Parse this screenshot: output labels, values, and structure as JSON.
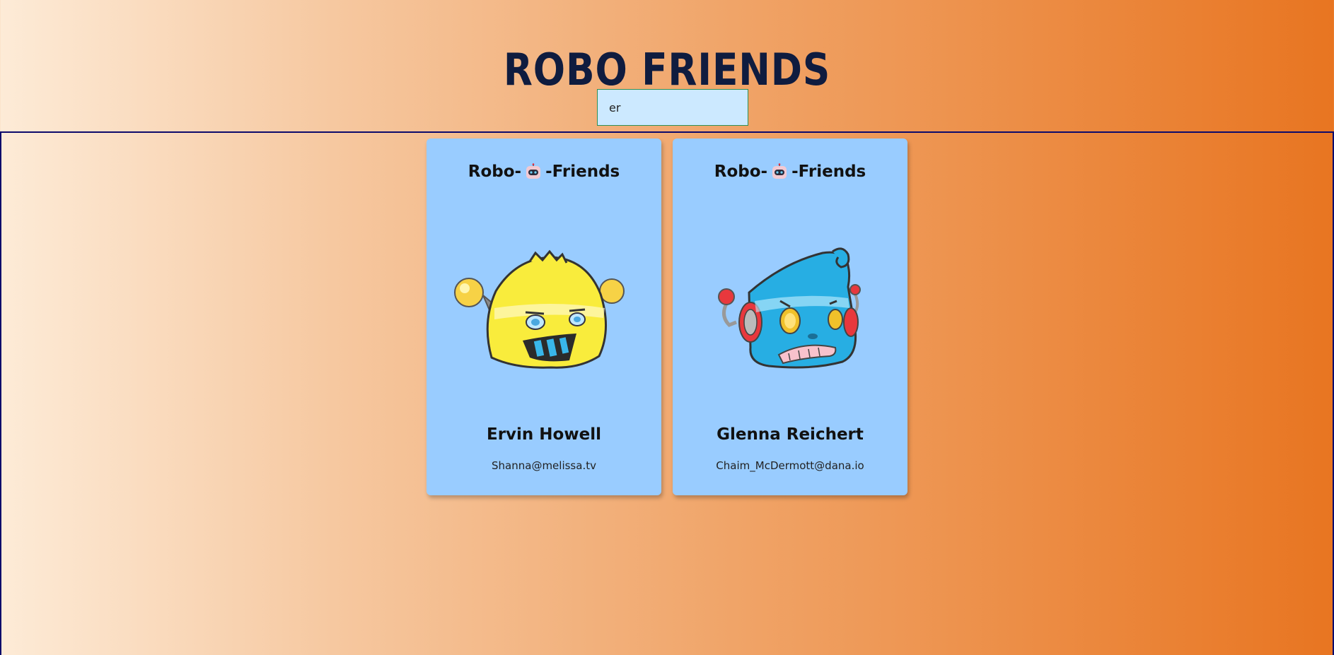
{
  "app": {
    "title": "Robo Friends"
  },
  "search": {
    "value": "er"
  },
  "cards": [
    {
      "heading_prefix": "Robo-",
      "heading_suffix": "-Friends",
      "heading_icon": "robot-face-icon",
      "avatar": "yellow-robot-avatar",
      "name": "Ervin Howell",
      "email": "Shanna@melissa.tv"
    },
    {
      "heading_prefix": "Robo-",
      "heading_suffix": "-Friends",
      "heading_icon": "robot-face-icon",
      "avatar": "blue-robot-avatar",
      "name": "Glenna Reichert",
      "email": "Chaim_McDermott@dana.io"
    }
  ],
  "colors": {
    "title": "#0f1c3f",
    "card_bg": "#99ccff",
    "search_bg": "#cce9ff",
    "search_border": "#2f8f56",
    "scroll_border": "#0c0a6b",
    "gradient_start": "#fdebd7",
    "gradient_end": "#e87521"
  }
}
